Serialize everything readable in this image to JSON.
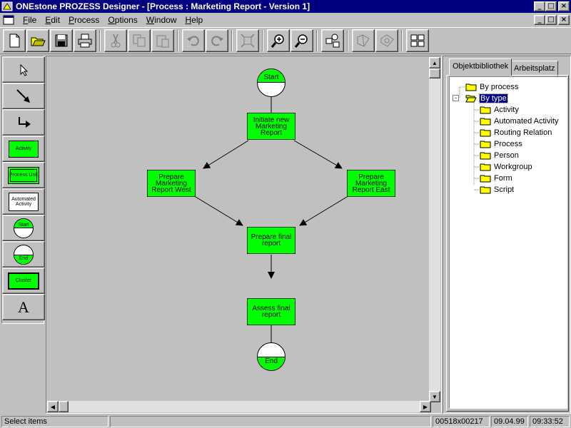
{
  "titlebar": {
    "title": "ONEstone PROZESS Designer - [Process : Marketing Report - Version 1]",
    "minimize": "_",
    "maximize": "□",
    "close": "×"
  },
  "menubar": {
    "items": [
      {
        "label": "File",
        "mnemonic": "F"
      },
      {
        "label": "Edit",
        "mnemonic": "E"
      },
      {
        "label": "Process",
        "mnemonic": "P"
      },
      {
        "label": "Options",
        "mnemonic": "O"
      },
      {
        "label": "Window",
        "mnemonic": "W"
      },
      {
        "label": "Help",
        "mnemonic": "H"
      }
    ]
  },
  "toolbar": {
    "icons": [
      "new-icon",
      "open-icon",
      "save-icon",
      "print-icon",
      "cut-icon",
      "copy-icon",
      "paste-icon",
      "undo-icon",
      "redo-icon",
      "fit-icon",
      "zoom-in-icon",
      "zoom-out-icon",
      "shapes-icon",
      "library-icon",
      "library-2-icon",
      "layout-icon"
    ]
  },
  "palette": {
    "items": [
      {
        "name": "select-tool",
        "label": ""
      },
      {
        "name": "link-tool",
        "label": ""
      },
      {
        "name": "routing-link-tool",
        "label": ""
      },
      {
        "name": "activity-tool",
        "label": "Activity"
      },
      {
        "name": "process-unit-tool",
        "label": "Process Unit"
      },
      {
        "name": "automated-activity-tool",
        "label": "Automated Activity"
      },
      {
        "name": "start-tool",
        "label": "Start"
      },
      {
        "name": "end-tool",
        "label": "End"
      },
      {
        "name": "cluster-tool",
        "label": "Cluster"
      },
      {
        "name": "text-tool",
        "label": "A"
      }
    ]
  },
  "diagram": {
    "start": "Start",
    "end": "End",
    "initiate": "Initiate new Marketing Report",
    "west": "Prepare Marketing Report West",
    "east": "Prepare Marketing Report East",
    "final": "Prepare final report",
    "assess": "Assess final report"
  },
  "rightpanel": {
    "tabs": [
      "Objektbibliothek",
      "Arbeitsplatz"
    ],
    "tree": {
      "by_process": "By process",
      "by_type": "By type",
      "children": [
        "Activity",
        "Automated Activity",
        "Routing Relation",
        "Process",
        "Person",
        "Workgroup",
        "Form",
        "Script"
      ]
    }
  },
  "statusbar": {
    "message": "Select items",
    "coords": "00518x00217",
    "date": "09.04.99",
    "time": "09:33:52"
  },
  "colors": {
    "node_green": "#00ff00",
    "title_blue": "#000080",
    "selection": "#000080"
  }
}
